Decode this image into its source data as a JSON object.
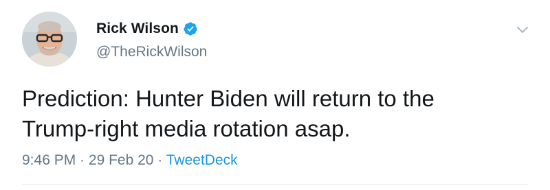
{
  "tweet": {
    "display_name": "Rick Wilson",
    "verified": true,
    "handle": "@TheRickWilson",
    "text_line_1": "Prediction: Hunter Biden will return to the",
    "text_line_2": "Trump-right media rotation asap.",
    "time": "9:46 PM",
    "separator": " · ",
    "date": "29 Feb 20",
    "source": "TweetDeck"
  },
  "icons": {
    "verified": "verified-badge-icon",
    "menu": "chevron-down-icon"
  },
  "colors": {
    "accent": "#1da1f2",
    "link": "#1b95e0",
    "secondary_text": "#657786",
    "primary_text": "#14171a",
    "divider": "#e1e8ed"
  }
}
